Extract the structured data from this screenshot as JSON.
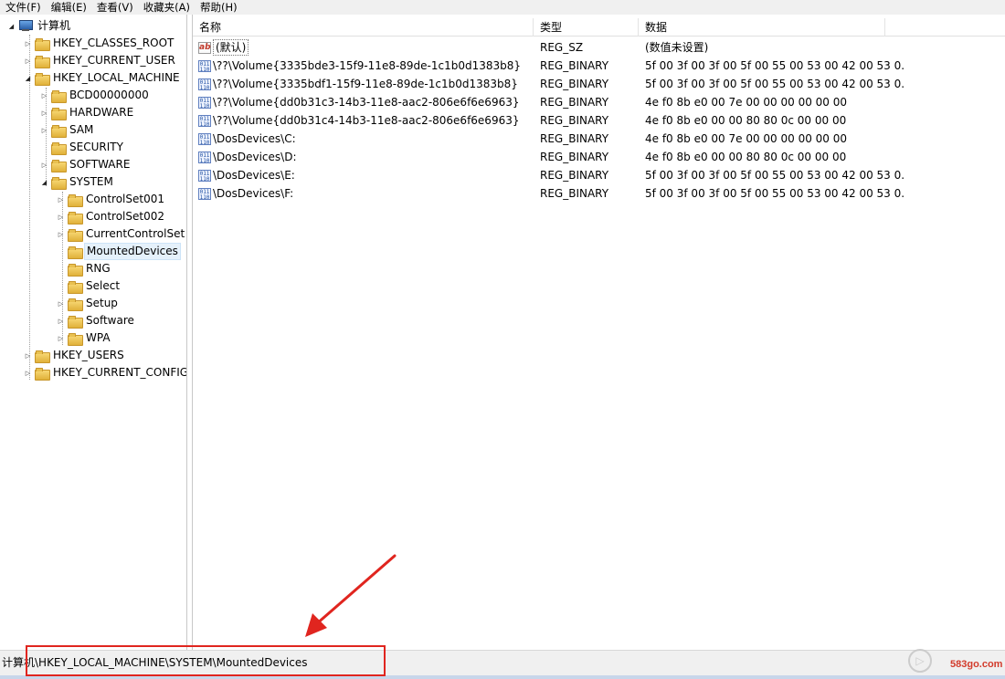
{
  "menu": [
    "文件(F)",
    "编辑(E)",
    "查看(V)",
    "收藏夹(A)",
    "帮助(H)"
  ],
  "tree": {
    "root": "计算机",
    "items": [
      {
        "label": "HKEY_CLASSES_ROOT"
      },
      {
        "label": "HKEY_CURRENT_USER"
      },
      {
        "label": "HKEY_LOCAL_MACHINE"
      },
      {
        "label": "BCD00000000"
      },
      {
        "label": "HARDWARE"
      },
      {
        "label": "SAM"
      },
      {
        "label": "SECURITY"
      },
      {
        "label": "SOFTWARE"
      },
      {
        "label": "SYSTEM"
      },
      {
        "label": "ControlSet001"
      },
      {
        "label": "ControlSet002"
      },
      {
        "label": "CurrentControlSet"
      },
      {
        "label": "MountedDevices"
      },
      {
        "label": "RNG"
      },
      {
        "label": "Select"
      },
      {
        "label": "Setup"
      },
      {
        "label": "Software"
      },
      {
        "label": "WPA"
      },
      {
        "label": "HKEY_USERS"
      },
      {
        "label": "HKEY_CURRENT_CONFIG"
      }
    ]
  },
  "list": {
    "headers": {
      "name": "名称",
      "type": "类型",
      "data": "数据"
    },
    "rows": [
      {
        "name": "(默认)",
        "type": "REG_SZ",
        "data": "(数值未设置)",
        "icon": "string-value-icon"
      },
      {
        "name": "\\??\\Volume{3335bde3-15f9-11e8-89de-1c1b0d1383b8}",
        "type": "REG_BINARY",
        "data": "5f 00 3f 00 3f 00 5f 00 55 00 53 00 42 00 53 0...",
        "icon": "binary-value-icon"
      },
      {
        "name": "\\??\\Volume{3335bdf1-15f9-11e8-89de-1c1b0d1383b8}",
        "type": "REG_BINARY",
        "data": "5f 00 3f 00 3f 00 5f 00 55 00 53 00 42 00 53 0...",
        "icon": "binary-value-icon"
      },
      {
        "name": "\\??\\Volume{dd0b31c3-14b3-11e8-aac2-806e6f6e6963}",
        "type": "REG_BINARY",
        "data": "4e f0 8b e0 00 7e 00 00 00 00 00 00",
        "icon": "binary-value-icon"
      },
      {
        "name": "\\??\\Volume{dd0b31c4-14b3-11e8-aac2-806e6f6e6963}",
        "type": "REG_BINARY",
        "data": "4e f0 8b e0 00 00 80 80 0c 00 00 00",
        "icon": "binary-value-icon"
      },
      {
        "name": "\\DosDevices\\C:",
        "type": "REG_BINARY",
        "data": "4e f0 8b e0 00 7e 00 00 00 00 00 00",
        "icon": "binary-value-icon"
      },
      {
        "name": "\\DosDevices\\D:",
        "type": "REG_BINARY",
        "data": "4e f0 8b e0 00 00 80 80 0c 00 00 00",
        "icon": "binary-value-icon"
      },
      {
        "name": "\\DosDevices\\E:",
        "type": "REG_BINARY",
        "data": "5f 00 3f 00 3f 00 5f 00 55 00 53 00 42 00 53 0...",
        "icon": "binary-value-icon"
      },
      {
        "name": "\\DosDevices\\F:",
        "type": "REG_BINARY",
        "data": "5f 00 3f 00 3f 00 5f 00 55 00 53 00 42 00 53 0...",
        "icon": "binary-value-icon"
      }
    ]
  },
  "status": {
    "path": "计算机\\HKEY_LOCAL_MACHINE\\SYSTEM\\MountedDevices"
  },
  "watermark": {
    "text": "583go.com"
  },
  "colors": {
    "annotation": "#e0251f",
    "selection": "#e5f1fb"
  }
}
